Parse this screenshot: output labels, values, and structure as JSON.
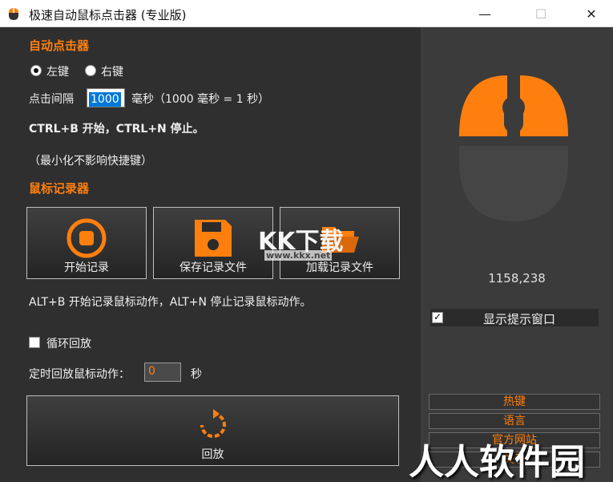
{
  "window": {
    "title": "极速自动鼠标点击器 (专业版)",
    "min_glyph": "—",
    "max_glyph": "☐",
    "close_glyph": "✕"
  },
  "clicker": {
    "section_title": "自动点击器",
    "left_key_label": "左键",
    "right_key_label": "右键",
    "selected_key": "left",
    "interval_label": "点击间隔",
    "interval_value": "1000",
    "interval_unit": "毫秒（1000 毫秒 = 1 秒）",
    "hotkey_text": "CTRL+B 开始，CTRL+N 停止。",
    "minimize_note": "（最小化不影响快捷键）"
  },
  "recorder": {
    "section_title": "鼠标记录器",
    "buttons": [
      {
        "label": "开始记录",
        "icon": "record-icon"
      },
      {
        "label": "保存记录文件",
        "icon": "floppy-disk-icon"
      },
      {
        "label": "加载记录文件",
        "icon": "folder-open-icon"
      }
    ],
    "hotkey_text": "ALT+B 开始记录鼠标动作，ALT+N 停止记录鼠标动作。",
    "loop_label": "循环回放",
    "loop_checked": false,
    "timed_label": "定时回放鼠标动作：",
    "timed_value": "0",
    "timed_unit": "秒",
    "replay_label": "回放",
    "replay_icon": "replay-icon"
  },
  "side": {
    "mouse_icon": "mouse-icon",
    "coordinates": "1158,238",
    "show_tip_label": "显示提示窗口",
    "show_tip_checked": true,
    "buttons": [
      "热键",
      "语言",
      "官方网站",
      "关于"
    ]
  },
  "watermarks": {
    "kk": "KK下载",
    "url": "www.kkx.net",
    "rr": "人人软件园"
  },
  "colors": {
    "accent": "#ff7f0e",
    "panel_dark": "#2f2f2f",
    "panel_side": "#3b3b3b",
    "mouse_bottom": "#454545"
  }
}
